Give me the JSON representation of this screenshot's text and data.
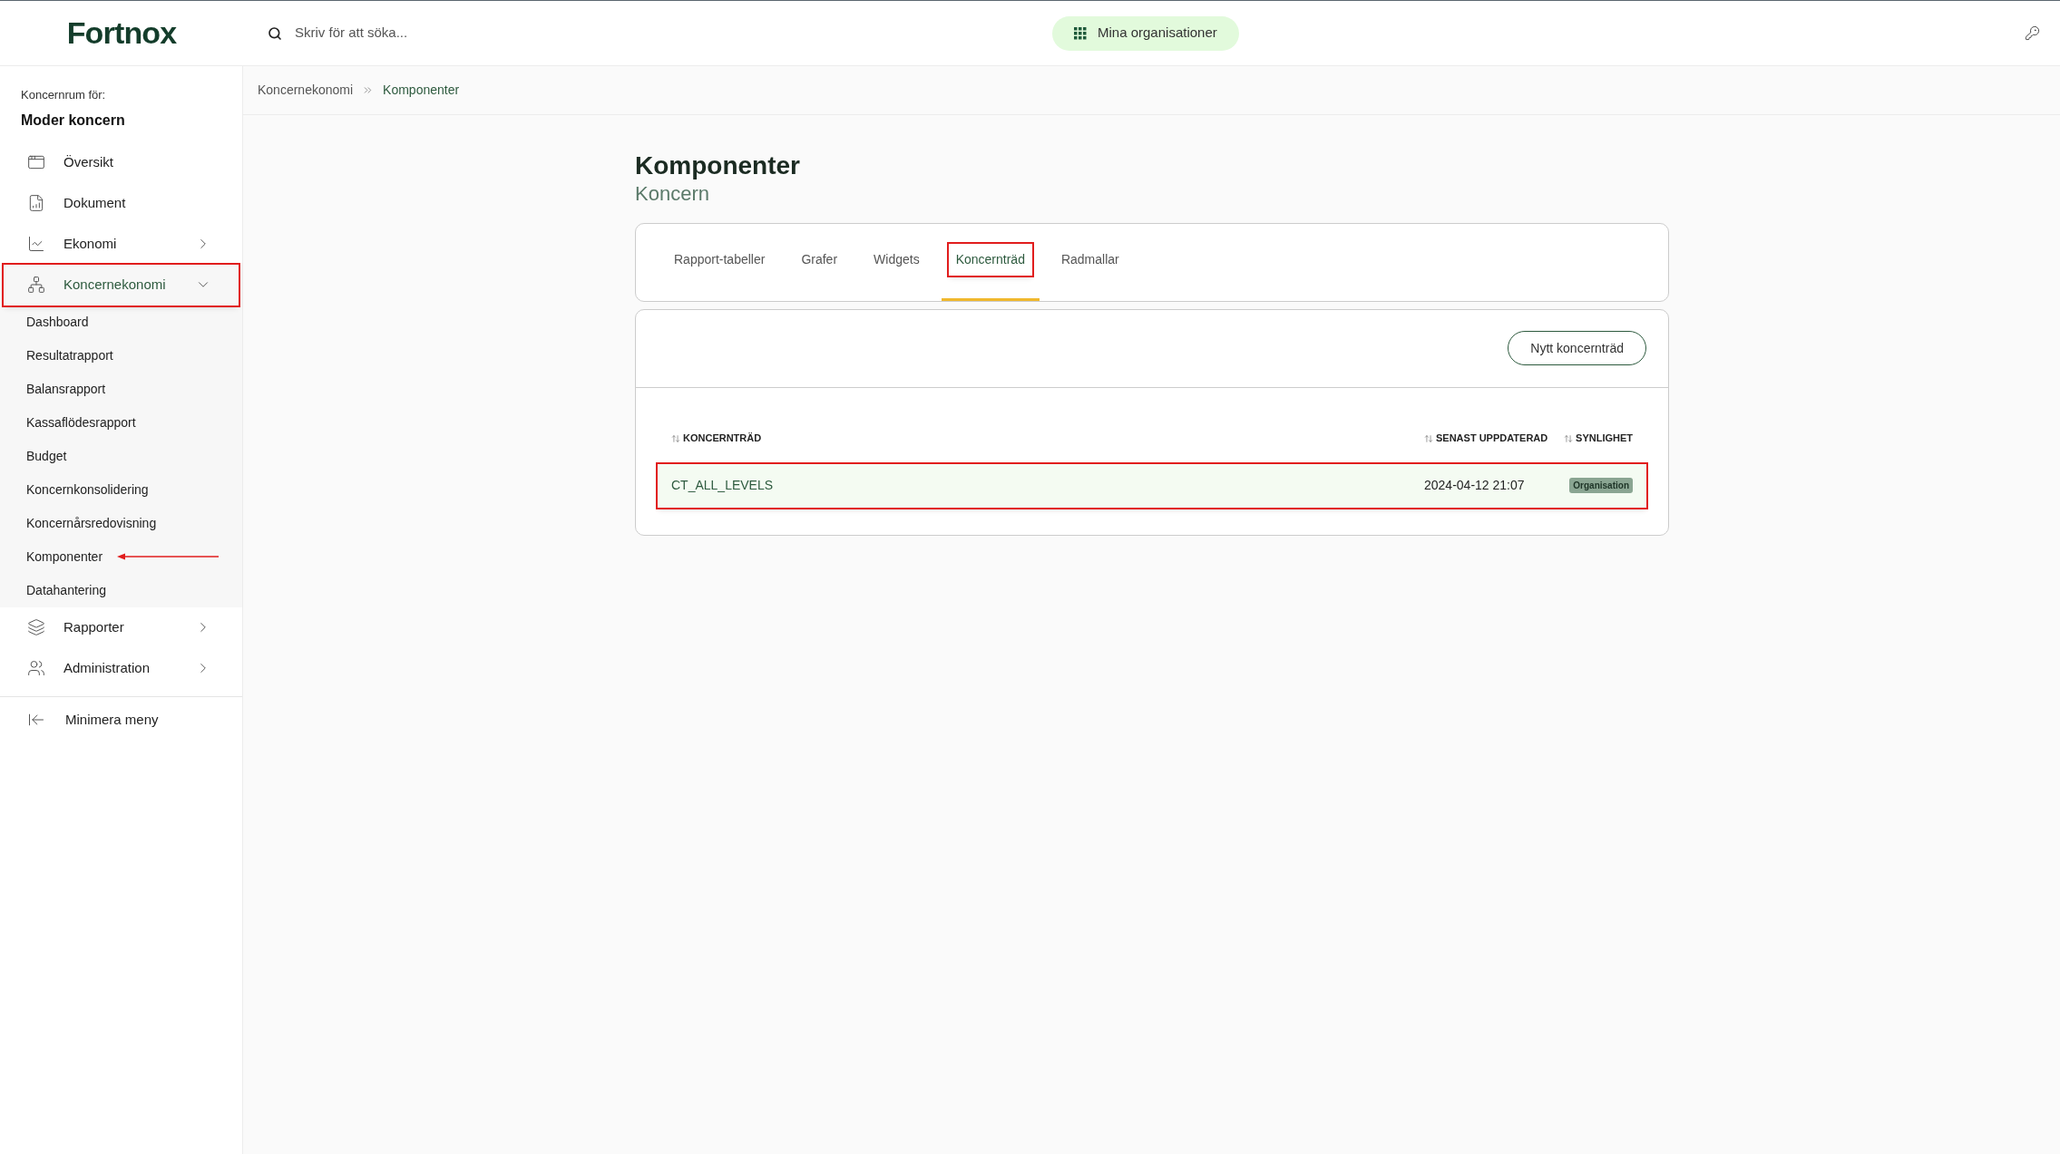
{
  "logo": "Fortnox",
  "search": {
    "placeholder": "Skriv för att söka..."
  },
  "org_button": "Mina organisationer",
  "sidebar": {
    "caption": "Koncernrum för:",
    "org": "Moder koncern",
    "items": [
      {
        "label": "Översikt",
        "expandable": false,
        "expanded": false,
        "annotated": false
      },
      {
        "label": "Dokument",
        "expandable": false,
        "expanded": false,
        "annotated": false
      },
      {
        "label": "Ekonomi",
        "expandable": true,
        "expanded": false,
        "annotated": false
      },
      {
        "label": "Koncernekonomi",
        "expandable": true,
        "expanded": true,
        "annotated": true,
        "children": [
          {
            "label": "Dashboard",
            "arrow": false
          },
          {
            "label": "Resultatrapport",
            "arrow": false
          },
          {
            "label": "Balansrapport",
            "arrow": false
          },
          {
            "label": "Kassaflödesrapport",
            "arrow": false
          },
          {
            "label": "Budget",
            "arrow": false
          },
          {
            "label": "Koncernkonsolidering",
            "arrow": false
          },
          {
            "label": "Koncernårsredovisning",
            "arrow": false
          },
          {
            "label": "Komponenter",
            "arrow": true
          },
          {
            "label": "Datahantering",
            "arrow": false
          }
        ]
      },
      {
        "label": "Rapporter",
        "expandable": true,
        "expanded": false,
        "annotated": false
      },
      {
        "label": "Administration",
        "expandable": true,
        "expanded": false,
        "annotated": false
      }
    ],
    "collapse": "Minimera meny"
  },
  "breadcrumb": [
    "Koncernekonomi",
    "Komponenter"
  ],
  "page": {
    "title": "Komponenter",
    "subtitle": "Koncern"
  },
  "tabs": [
    {
      "label": "Rapport-tabeller",
      "selected": false,
      "annotated": false
    },
    {
      "label": "Grafer",
      "selected": false,
      "annotated": false
    },
    {
      "label": "Widgets",
      "selected": false,
      "annotated": false
    },
    {
      "label": "Koncernträd",
      "selected": true,
      "annotated": true
    },
    {
      "label": "Radmallar",
      "selected": false,
      "annotated": false
    }
  ],
  "new_button": "Nytt koncernträd",
  "table": {
    "columns": [
      "KONCERNTRÄD",
      "SENAST UPPDATERAD",
      "SYNLIGHET"
    ],
    "rows": [
      {
        "name": "CT_ALL_LEVELS",
        "updated": "2024-04-12 21:07",
        "visibility": "Organisation",
        "annotated": true
      }
    ]
  }
}
